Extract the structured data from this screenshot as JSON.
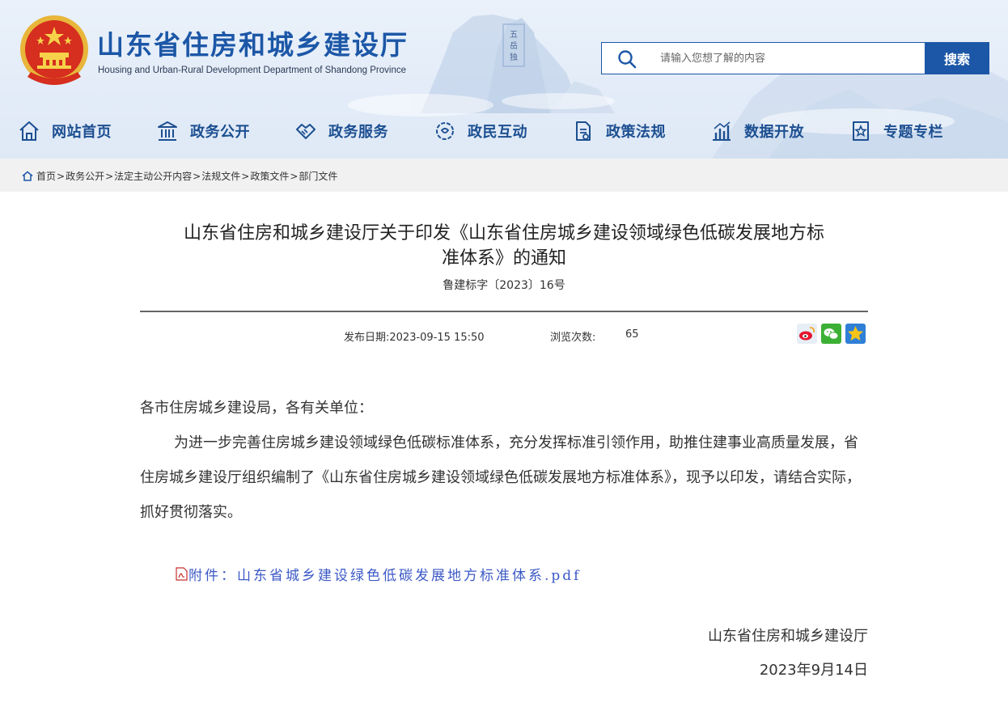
{
  "header": {
    "site_title": "山东省住房和城乡建设厅",
    "site_subtitle": "Housing and Urban-Rural Development Department of Shandong Province",
    "emblem_icon": "national-emblem-icon",
    "search": {
      "placeholder": "请输入您想了解的内容",
      "value": "",
      "button_label": "搜索",
      "icon": "search-icon"
    },
    "nav": [
      {
        "label": "网站首页",
        "icon": "home-icon"
      },
      {
        "label": "政务公开",
        "icon": "building-icon"
      },
      {
        "label": "政务服务",
        "icon": "handshake-icon"
      },
      {
        "label": "政民互动",
        "icon": "interaction-icon"
      },
      {
        "label": "政策法规",
        "icon": "document-icon"
      },
      {
        "label": "数据开放",
        "icon": "bar-chart-icon"
      },
      {
        "label": "专题专栏",
        "icon": "star-document-icon"
      }
    ]
  },
  "breadcrumb": {
    "icon": "home-icon",
    "items": [
      "首页",
      "政务公开",
      "法定主动公开内容",
      "法规文件",
      "政策文件",
      "部门文件"
    ],
    "separator": ">"
  },
  "article": {
    "title_line1": "山东省住房和城乡建设厅关于印发《山东省住房城乡建设领域绿色低碳发展地方标",
    "title_line2": "准体系》的通知",
    "doc_number": "鲁建标字〔2023〕16号",
    "publish_date": "发布日期:2023-09-15 15:50",
    "views_label": "浏览次数:",
    "views_value": "65",
    "share_icons": [
      "weibo-icon",
      "wechat-icon",
      "qzone-icon"
    ],
    "salutation": "各市住房城乡建设局，各有关单位：",
    "paragraph": "为进一步完善住房城乡建设领域绿色低碳标准体系，充分发挥标准引领作用，助推住建事业高质量发展，省住房城乡建设厅组织编制了《山东省住房城乡建设领域绿色低碳发展地方标准体系》，现予以印发，请结合实际，抓好贯彻落实。",
    "attachment": {
      "label": "附件：山东省城乡建设绿色低碳发展地方标准体系.pdf",
      "icon": "pdf-icon"
    },
    "signature_org": "山东省住房和城乡建设厅",
    "signature_date": "2023年9月14日"
  },
  "colors": {
    "brand_blue": "#1c57a7",
    "nav_text": "#1c4f91",
    "link_blue": "#3b59c6",
    "header_bg": "#e3ecf8",
    "breadcrumb_bg": "#f1f1f1"
  }
}
